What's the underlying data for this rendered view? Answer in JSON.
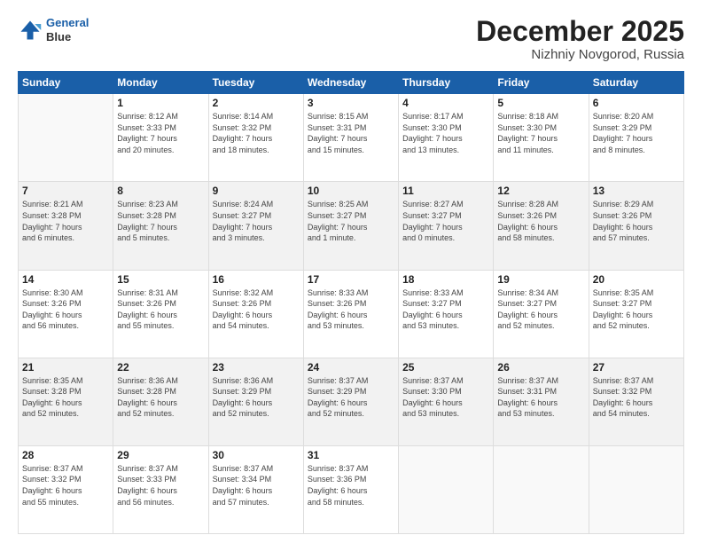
{
  "header": {
    "logo_line1": "General",
    "logo_line2": "Blue",
    "title": "December 2025",
    "subtitle": "Nizhniy Novgorod, Russia"
  },
  "calendar": {
    "headers": [
      "Sunday",
      "Monday",
      "Tuesday",
      "Wednesday",
      "Thursday",
      "Friday",
      "Saturday"
    ],
    "rows": [
      [
        {
          "day": "",
          "info": ""
        },
        {
          "day": "1",
          "info": "Sunrise: 8:12 AM\nSunset: 3:33 PM\nDaylight: 7 hours\nand 20 minutes."
        },
        {
          "day": "2",
          "info": "Sunrise: 8:14 AM\nSunset: 3:32 PM\nDaylight: 7 hours\nand 18 minutes."
        },
        {
          "day": "3",
          "info": "Sunrise: 8:15 AM\nSunset: 3:31 PM\nDaylight: 7 hours\nand 15 minutes."
        },
        {
          "day": "4",
          "info": "Sunrise: 8:17 AM\nSunset: 3:30 PM\nDaylight: 7 hours\nand 13 minutes."
        },
        {
          "day": "5",
          "info": "Sunrise: 8:18 AM\nSunset: 3:30 PM\nDaylight: 7 hours\nand 11 minutes."
        },
        {
          "day": "6",
          "info": "Sunrise: 8:20 AM\nSunset: 3:29 PM\nDaylight: 7 hours\nand 8 minutes."
        }
      ],
      [
        {
          "day": "7",
          "info": "Sunrise: 8:21 AM\nSunset: 3:28 PM\nDaylight: 7 hours\nand 6 minutes."
        },
        {
          "day": "8",
          "info": "Sunrise: 8:23 AM\nSunset: 3:28 PM\nDaylight: 7 hours\nand 5 minutes."
        },
        {
          "day": "9",
          "info": "Sunrise: 8:24 AM\nSunset: 3:27 PM\nDaylight: 7 hours\nand 3 minutes."
        },
        {
          "day": "10",
          "info": "Sunrise: 8:25 AM\nSunset: 3:27 PM\nDaylight: 7 hours\nand 1 minute."
        },
        {
          "day": "11",
          "info": "Sunrise: 8:27 AM\nSunset: 3:27 PM\nDaylight: 7 hours\nand 0 minutes."
        },
        {
          "day": "12",
          "info": "Sunrise: 8:28 AM\nSunset: 3:26 PM\nDaylight: 6 hours\nand 58 minutes."
        },
        {
          "day": "13",
          "info": "Sunrise: 8:29 AM\nSunset: 3:26 PM\nDaylight: 6 hours\nand 57 minutes."
        }
      ],
      [
        {
          "day": "14",
          "info": "Sunrise: 8:30 AM\nSunset: 3:26 PM\nDaylight: 6 hours\nand 56 minutes."
        },
        {
          "day": "15",
          "info": "Sunrise: 8:31 AM\nSunset: 3:26 PM\nDaylight: 6 hours\nand 55 minutes."
        },
        {
          "day": "16",
          "info": "Sunrise: 8:32 AM\nSunset: 3:26 PM\nDaylight: 6 hours\nand 54 minutes."
        },
        {
          "day": "17",
          "info": "Sunrise: 8:33 AM\nSunset: 3:26 PM\nDaylight: 6 hours\nand 53 minutes."
        },
        {
          "day": "18",
          "info": "Sunrise: 8:33 AM\nSunset: 3:27 PM\nDaylight: 6 hours\nand 53 minutes."
        },
        {
          "day": "19",
          "info": "Sunrise: 8:34 AM\nSunset: 3:27 PM\nDaylight: 6 hours\nand 52 minutes."
        },
        {
          "day": "20",
          "info": "Sunrise: 8:35 AM\nSunset: 3:27 PM\nDaylight: 6 hours\nand 52 minutes."
        }
      ],
      [
        {
          "day": "21",
          "info": "Sunrise: 8:35 AM\nSunset: 3:28 PM\nDaylight: 6 hours\nand 52 minutes."
        },
        {
          "day": "22",
          "info": "Sunrise: 8:36 AM\nSunset: 3:28 PM\nDaylight: 6 hours\nand 52 minutes."
        },
        {
          "day": "23",
          "info": "Sunrise: 8:36 AM\nSunset: 3:29 PM\nDaylight: 6 hours\nand 52 minutes."
        },
        {
          "day": "24",
          "info": "Sunrise: 8:37 AM\nSunset: 3:29 PM\nDaylight: 6 hours\nand 52 minutes."
        },
        {
          "day": "25",
          "info": "Sunrise: 8:37 AM\nSunset: 3:30 PM\nDaylight: 6 hours\nand 53 minutes."
        },
        {
          "day": "26",
          "info": "Sunrise: 8:37 AM\nSunset: 3:31 PM\nDaylight: 6 hours\nand 53 minutes."
        },
        {
          "day": "27",
          "info": "Sunrise: 8:37 AM\nSunset: 3:32 PM\nDaylight: 6 hours\nand 54 minutes."
        }
      ],
      [
        {
          "day": "28",
          "info": "Sunrise: 8:37 AM\nSunset: 3:32 PM\nDaylight: 6 hours\nand 55 minutes."
        },
        {
          "day": "29",
          "info": "Sunrise: 8:37 AM\nSunset: 3:33 PM\nDaylight: 6 hours\nand 56 minutes."
        },
        {
          "day": "30",
          "info": "Sunrise: 8:37 AM\nSunset: 3:34 PM\nDaylight: 6 hours\nand 57 minutes."
        },
        {
          "day": "31",
          "info": "Sunrise: 8:37 AM\nSunset: 3:36 PM\nDaylight: 6 hours\nand 58 minutes."
        },
        {
          "day": "",
          "info": ""
        },
        {
          "day": "",
          "info": ""
        },
        {
          "day": "",
          "info": ""
        }
      ]
    ]
  }
}
